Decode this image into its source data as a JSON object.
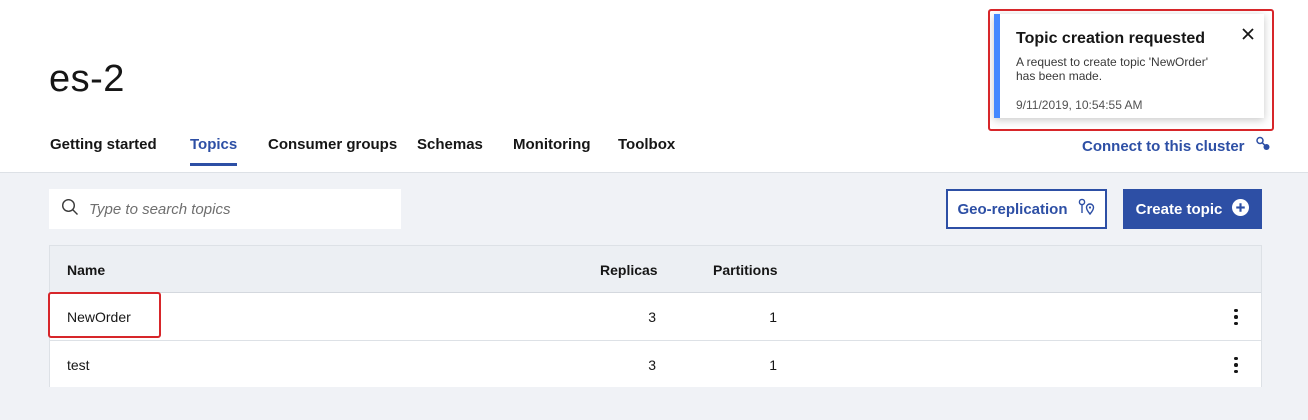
{
  "header": {
    "title": "es-2",
    "tabs": [
      {
        "label": "Getting started",
        "active": false
      },
      {
        "label": "Topics",
        "active": true
      },
      {
        "label": "Consumer groups",
        "active": false
      },
      {
        "label": "Schemas",
        "active": false
      },
      {
        "label": "Monitoring",
        "active": false
      },
      {
        "label": "Toolbox",
        "active": false
      }
    ],
    "connect_label": "Connect to this cluster",
    "connect_icon": "connect-icon"
  },
  "toolbar": {
    "search_placeholder": "Type to search topics",
    "search_value": "",
    "search_icon": "search-icon",
    "geo_label": "Geo-replication",
    "geo_icon": "geo-replication-icon",
    "create_label": "Create topic",
    "create_icon": "add-circle-icon"
  },
  "table": {
    "columns": [
      "Name",
      "Replicas",
      "Partitions"
    ],
    "rows": [
      {
        "name": "NewOrder",
        "replicas": "3",
        "partitions": "1"
      },
      {
        "name": "test",
        "replicas": "3",
        "partitions": "1"
      }
    ],
    "row_menu_icon": "overflow-menu-icon"
  },
  "toast": {
    "title": "Topic creation requested",
    "body": "A request to create topic 'NewOrder' has been made.",
    "timestamp": "9/11/2019, 10:54:55 AM",
    "close_icon": "close-icon"
  },
  "colors": {
    "accent": "#2d4fa5",
    "toast_stripe": "#4589ff",
    "highlight": "#d7262a",
    "background": "#f0f2f6"
  }
}
